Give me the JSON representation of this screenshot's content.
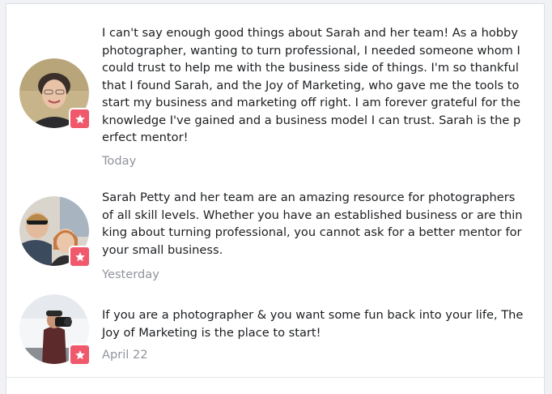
{
  "reviews": [
    {
      "text": "I can't say enough good things about Sarah and her team!  As a hobby photographer, wanting to turn professional, I needed someone whom I could trust to help me with the business side of things.  I'm so thankful that I found Sarah, and the Joy of Marketing, who gave me the tools to start my business and marketing off right. I am forever grateful for the knowledge I've gained and a business model I can trust.  Sarah is the perfect mentor!",
      "date": "Today"
    },
    {
      "text": "Sarah Petty and her team are an amazing resource for photographers of all skill levels. Whether you have an established business or are thinking about turning professional, you cannot ask for a better mentor for your small business.",
      "date": "Yesterday"
    },
    {
      "text": "If you are a photographer & you want some fun back into your life, The Joy of Marketing is the place to start!",
      "date": "April 22"
    }
  ],
  "badge_icon": "star-icon",
  "colors": {
    "badge": "#f0596b",
    "date_text": "#90949c",
    "body_text": "#1c1e21"
  }
}
